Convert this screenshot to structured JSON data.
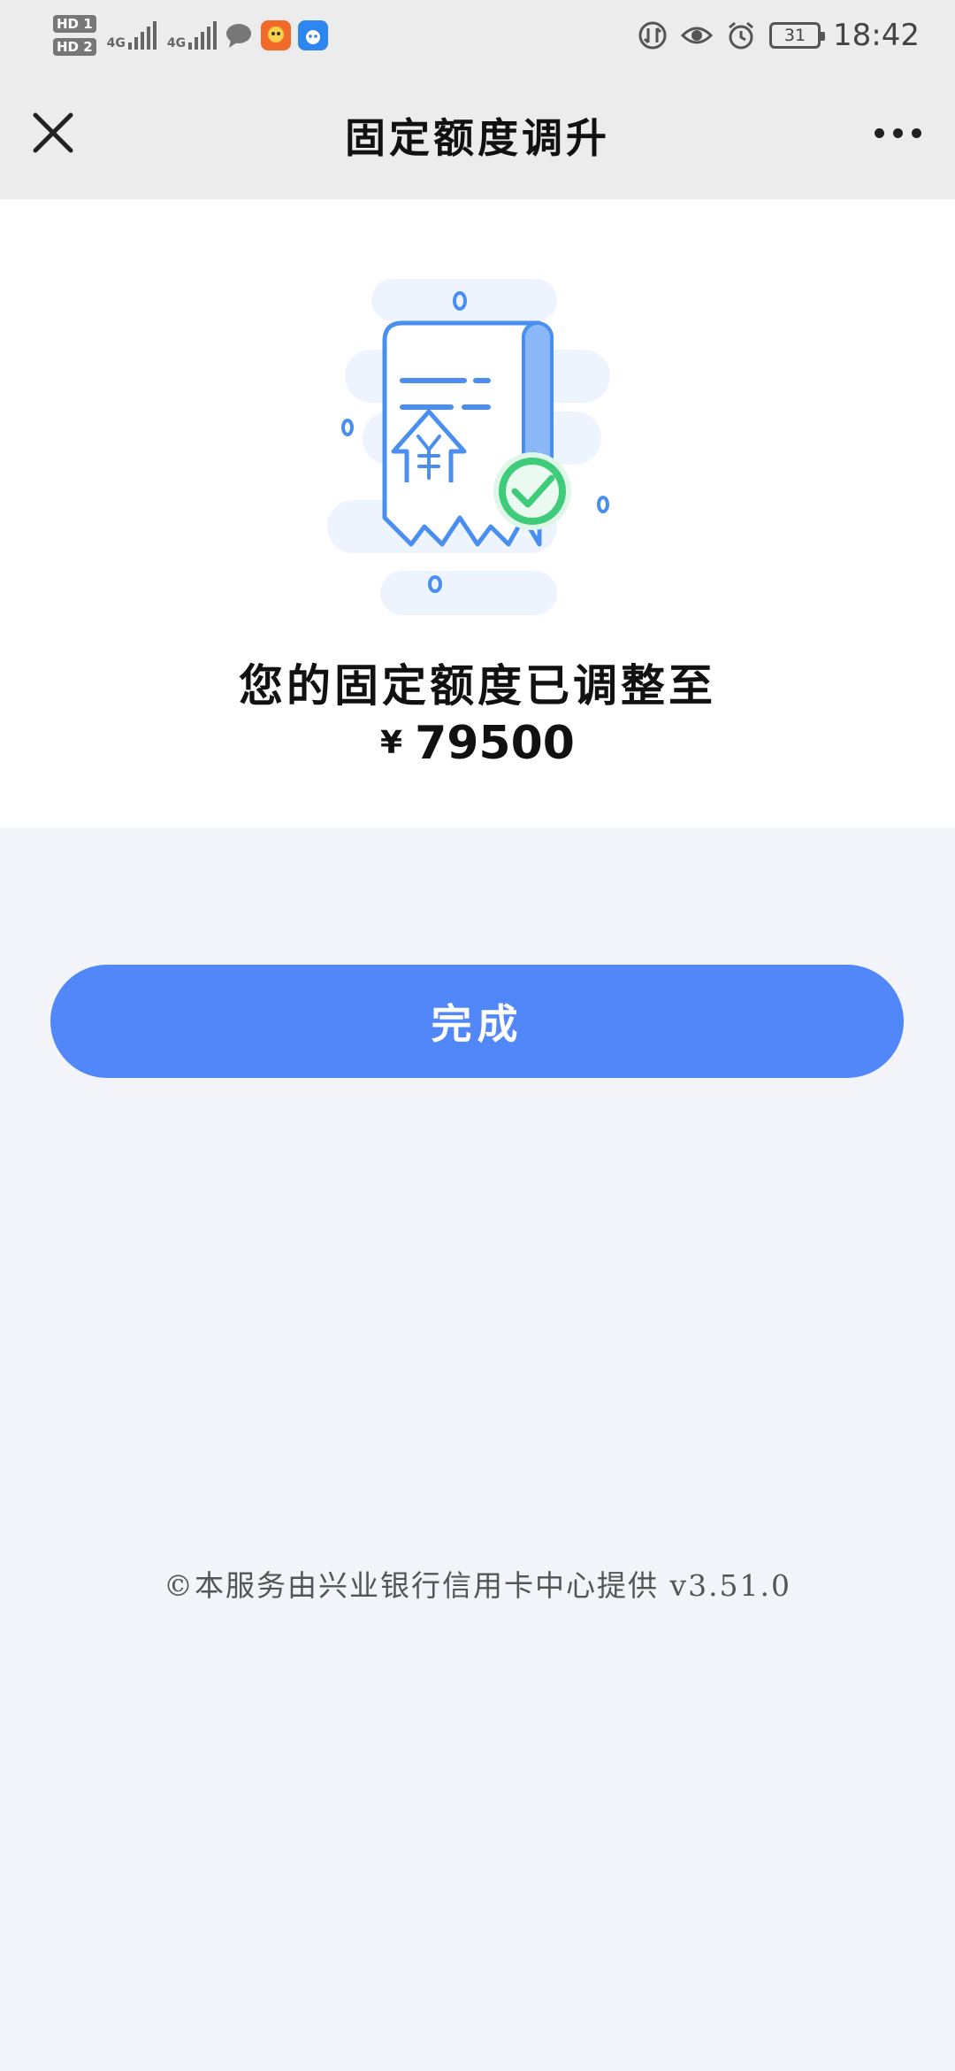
{
  "status_bar": {
    "sim1": "HD 1",
    "sim2": "HD 2",
    "net1": "4G",
    "net2": "4G",
    "battery": "31",
    "time": "18:42"
  },
  "navbar": {
    "title": "固定额度调升"
  },
  "result": {
    "message": "您的固定额度已调整至",
    "currency": "¥",
    "amount": "79500"
  },
  "actions": {
    "done_label": "完成"
  },
  "footer": {
    "text": "©本服务由兴业银行信用卡中心提供 v3.51.0"
  },
  "colors": {
    "primary": "#5187f8",
    "success": "#3ecb7a",
    "page_bg": "#f2f4f9",
    "header_bg": "#ececec"
  }
}
